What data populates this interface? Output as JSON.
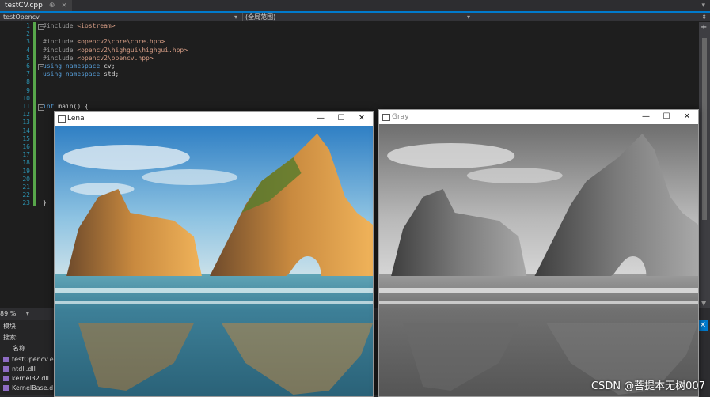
{
  "tab": {
    "title": "testCV.cpp",
    "pin": "⊕",
    "close": "×"
  },
  "nav": {
    "project": "testOpencv",
    "scope": "(全局范围)"
  },
  "editor": {
    "line_numbers": [
      "1",
      "2",
      "3",
      "4",
      "5",
      "6",
      "7",
      "8",
      "9",
      "10",
      "11",
      "12",
      "13",
      "14",
      "15",
      "16",
      "17",
      "18",
      "19",
      "20",
      "21",
      "22",
      "23"
    ],
    "lines": [
      {
        "n": 1,
        "parts": [
          {
            "t": "#include ",
            "c": "pp"
          },
          {
            "t": "<iostream>",
            "c": "inc"
          }
        ]
      },
      {
        "n": 3,
        "parts": [
          {
            "t": "#include ",
            "c": "pp"
          },
          {
            "t": "<opencv2\\core\\core.hpp>",
            "c": "inc"
          }
        ]
      },
      {
        "n": 4,
        "parts": [
          {
            "t": "#include ",
            "c": "pp"
          },
          {
            "t": "<opencv2\\highgui\\highgui.hpp>",
            "c": "inc"
          }
        ]
      },
      {
        "n": 5,
        "parts": [
          {
            "t": "#include ",
            "c": "pp"
          },
          {
            "t": "<opencv2\\opencv.hpp>",
            "c": "inc"
          }
        ]
      },
      {
        "n": 6,
        "parts": [
          {
            "t": "using ",
            "c": "kw"
          },
          {
            "t": "namespace ",
            "c": "kw"
          },
          {
            "t": "cv;",
            "c": ""
          }
        ]
      },
      {
        "n": 7,
        "parts": [
          {
            "t": "using ",
            "c": "kw"
          },
          {
            "t": "namespace ",
            "c": "kw"
          },
          {
            "t": "std;",
            "c": ""
          }
        ]
      },
      {
        "n": 11,
        "parts": [
          {
            "t": "int ",
            "c": "kw"
          },
          {
            "t": "main() {",
            "c": ""
          }
        ]
      },
      {
        "n": 23,
        "parts": [
          {
            "t": "}",
            "c": ""
          }
        ]
      }
    ]
  },
  "zoom": {
    "level": "89 %"
  },
  "modules": {
    "title": "模块",
    "search_label": "搜索:",
    "column_name": "名称",
    "items": [
      "testOpencv.exe",
      "ntdll.dll",
      "kernel32.dll",
      "KernelBase.dll"
    ]
  },
  "windows": {
    "lena": {
      "title": "Lena",
      "minimize": "—",
      "maximize": "☐",
      "close": "✕"
    },
    "gray": {
      "title": "Gray",
      "minimize": "—",
      "maximize": "☐",
      "close": "✕"
    }
  },
  "scrollbar": {
    "plus": "+",
    "down": "▼"
  },
  "side_close": "✕",
  "watermark": "CSDN @菩提本无树007",
  "colors": {
    "accent": "#007acc",
    "editor_bg": "#1e1e1e",
    "line_number": "#2b91af",
    "keyword": "#569cd6",
    "string": "#d69d85"
  }
}
